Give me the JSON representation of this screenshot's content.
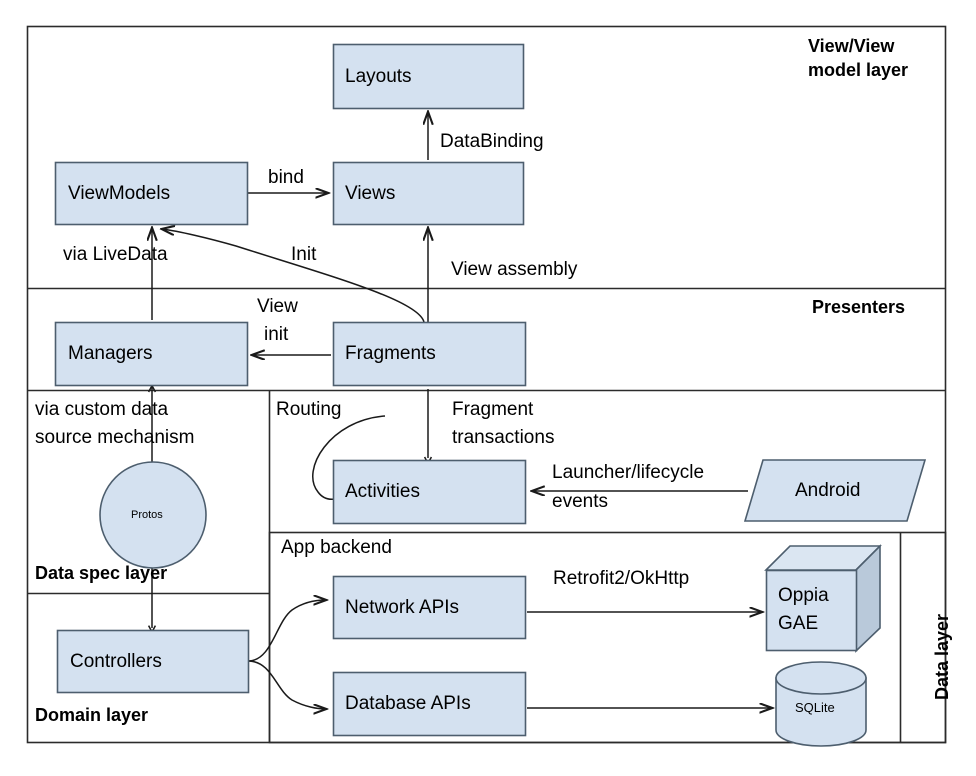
{
  "diagram": {
    "title": "Oppia Android app architecture layers",
    "colors": {
      "node_fill": "#d4e1f0",
      "node_stroke": "#4d5e6e",
      "border": "#2b2b2b",
      "edge": "#1a1a1a",
      "text": "#000000",
      "cube_top": "#dbe6f2",
      "cube_side": "#b9c9da"
    },
    "layers": [
      {
        "id": "view-layer",
        "label": "View/View\nmodel layer"
      },
      {
        "id": "presenters-layer",
        "label": "Presenters"
      },
      {
        "id": "data-spec-layer",
        "label": "Data spec layer"
      },
      {
        "id": "domain-layer",
        "label": "Domain layer"
      },
      {
        "id": "data-layer",
        "label": "Data layer"
      }
    ],
    "groups": [
      {
        "id": "app-backend",
        "label": "App backend"
      }
    ],
    "nodes": [
      {
        "id": "layouts",
        "label": "Layouts",
        "shape": "rect"
      },
      {
        "id": "views",
        "label": "Views",
        "shape": "rect"
      },
      {
        "id": "viewmodels",
        "label": "ViewModels",
        "shape": "rect"
      },
      {
        "id": "managers",
        "label": "Managers",
        "shape": "rect"
      },
      {
        "id": "fragments",
        "label": "Fragments",
        "shape": "rect"
      },
      {
        "id": "activities",
        "label": "Activities",
        "shape": "rect"
      },
      {
        "id": "android",
        "label": "Android",
        "shape": "parallelogram"
      },
      {
        "id": "protos",
        "label": "Protos",
        "shape": "circle"
      },
      {
        "id": "controllers",
        "label": "Controllers",
        "shape": "rect"
      },
      {
        "id": "network-apis",
        "label": "Network APIs",
        "shape": "rect"
      },
      {
        "id": "database-apis",
        "label": "Database APIs",
        "shape": "rect"
      },
      {
        "id": "oppia-gae",
        "label": "Oppia\nGAE",
        "shape": "cube"
      },
      {
        "id": "sqlite",
        "label": "SQLite",
        "shape": "cylinder"
      }
    ],
    "edges": [
      {
        "id": "views-to-layouts",
        "from": "views",
        "to": "layouts",
        "label": "DataBinding"
      },
      {
        "id": "viewmodels-to-views",
        "from": "viewmodels",
        "to": "views",
        "label": "bind"
      },
      {
        "id": "managers-to-viewmodels",
        "from": "managers",
        "to": "viewmodels",
        "label": "via LiveData"
      },
      {
        "id": "fragments-to-viewmodels",
        "from": "fragments",
        "to": "viewmodels",
        "label": "Init"
      },
      {
        "id": "fragments-to-views",
        "from": "fragments",
        "to": "views",
        "label": "View assembly"
      },
      {
        "id": "fragments-to-managers",
        "from": "fragments",
        "to": "managers",
        "label": "View\ninit"
      },
      {
        "id": "activities-self",
        "from": "activities",
        "to": "activities",
        "label": "Routing"
      },
      {
        "id": "activities-to-fragments",
        "from": "activities",
        "to": "fragments",
        "label": "Fragment\ntransactions"
      },
      {
        "id": "android-to-activities",
        "from": "android",
        "to": "activities",
        "label": "Launcher/lifecycle\nevents"
      },
      {
        "id": "controllers-to-managers",
        "from": "controllers",
        "to": "managers",
        "label": "via custom data\nsource mechanism"
      },
      {
        "id": "controllers-to-network",
        "from": "controllers",
        "to": "network-apis",
        "label": ""
      },
      {
        "id": "controllers-to-database",
        "from": "controllers",
        "to": "database-apis",
        "label": ""
      },
      {
        "id": "network-to-gae",
        "from": "network-apis",
        "to": "oppia-gae",
        "label": "Retrofit2/OkHttp"
      },
      {
        "id": "database-to-sqlite",
        "from": "database-apis",
        "to": "sqlite",
        "label": ""
      }
    ],
    "edge_labels": {
      "databinding": "DataBinding",
      "bind": "bind",
      "via_livedata": "via LiveData",
      "init": "Init",
      "view_assembly": "View assembly",
      "view_init_1": "View",
      "view_init_2": "init",
      "routing": "Routing",
      "fragment_transactions_1": "Fragment",
      "fragment_transactions_2": "transactions",
      "launcher_1": "Launcher/lifecycle",
      "launcher_2": "events",
      "via_custom_1": "via custom data",
      "via_custom_2": "source mechanism",
      "retrofit": "Retrofit2/OkHttp"
    },
    "node_labels": {
      "layouts": "Layouts",
      "views": "Views",
      "viewmodels": "ViewModels",
      "managers": "Managers",
      "fragments": "Fragments",
      "activities": "Activities",
      "android": "Android",
      "protos": "Protos",
      "controllers": "Controllers",
      "network_apis": "Network APIs",
      "database_apis": "Database APIs",
      "oppia_gae_1": "Oppia",
      "oppia_gae_2": "GAE",
      "sqlite": "SQLite"
    },
    "layer_labels": {
      "view_model_1": "View/View",
      "view_model_2": "model layer",
      "presenters": "Presenters",
      "data_spec": "Data spec layer",
      "domain": "Domain layer",
      "data_layer": "Data layer",
      "app_backend": "App backend"
    }
  }
}
